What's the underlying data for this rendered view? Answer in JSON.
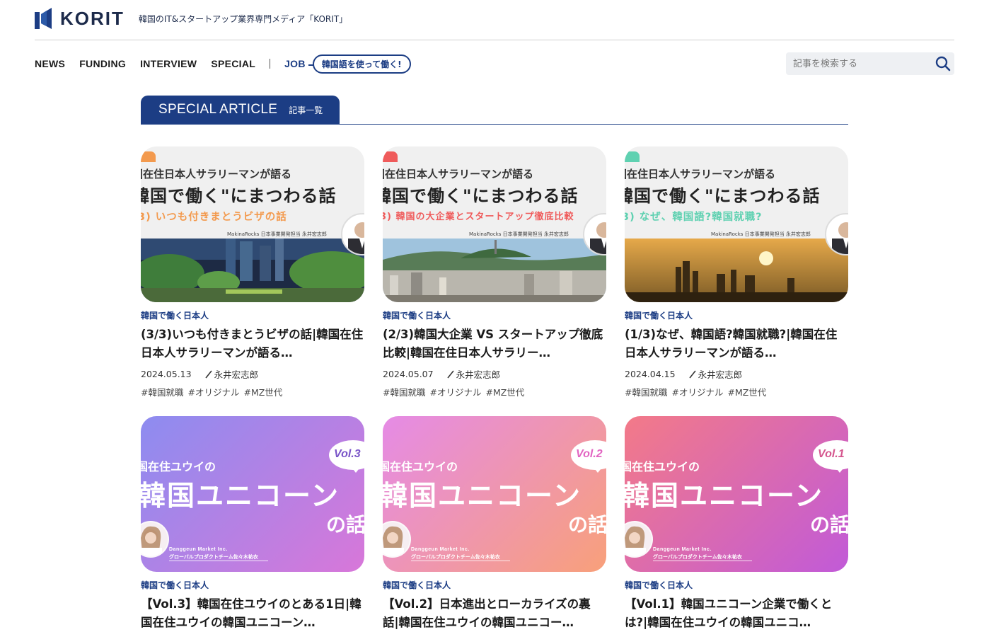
{
  "header": {
    "logo_text": "KORIT",
    "tagline": "韓国のIT&スタートアップ業界専門メディア「KORIT」",
    "brand_color": "#1c3d84"
  },
  "nav": {
    "items": [
      {
        "label": "NEWS"
      },
      {
        "label": "FUNDING"
      },
      {
        "label": "INTERVIEW"
      },
      {
        "label": "SPECIAL"
      }
    ],
    "job_label": "JOB",
    "job_bubble": "韓国語を使って働く!"
  },
  "search": {
    "placeholder": "記事を検索する",
    "icon": "search-icon"
  },
  "section": {
    "title": "SPECIAL ARTICLE",
    "subtitle": "記事一覧"
  },
  "cards": [
    {
      "category": "韓国で働く日本人",
      "title": "(3/3)いつも付きまとうビザの話|韓国在住日本人サラリーマンが語る…",
      "date": "2024.05.13",
      "author": "永井宏志郎",
      "tags": [
        "#韓国就職",
        "#オリジナル",
        "#MZ世代"
      ],
      "thumb": {
        "line1": "国在住日本人サラリーマンが語る",
        "line2": "韓国で働く\"にまつわる話",
        "line3": "3) いつも付きまとうビザの話",
        "credit": "MakinaRocks 日本事業開発担当 永井宏志郎",
        "accent": "#f39a4e"
      }
    },
    {
      "category": "韓国で働く日本人",
      "title": "(2/3)韓国大企業 VS スタートアップ徹底比較|韓国在住日本人サラリー…",
      "date": "2024.05.07",
      "author": "永井宏志郎",
      "tags": [
        "#韓国就職",
        "#オリジナル",
        "#MZ世代"
      ],
      "thumb": {
        "line1": "国在住日本人サラリーマンが語る",
        "line2": "韓国で働く\"にまつわる話",
        "line3": "3) 韓国の大企業とスタートアップ徹底比較",
        "credit": "MakinaRocks 日本事業開発担当 永井宏志郎",
        "accent": "#ef5b5b"
      }
    },
    {
      "category": "韓国で働く日本人",
      "title": "(1/3)なぜ、韓国語?韓国就職?|韓国在住日本人サラリーマンが語る…",
      "date": "2024.04.15",
      "author": "永井宏志郎",
      "tags": [
        "#韓国就職",
        "#オリジナル",
        "#MZ世代"
      ],
      "thumb": {
        "line1": "国在住日本人サラリーマンが語る",
        "line2": "韓国で働く\"にまつわる話",
        "line3": "3) なぜ、韓国語?韓国就職?",
        "credit": "MakinaRocks 日本事業開発担当 永井宏志郎",
        "accent": "#5fd1b1"
      }
    },
    {
      "category": "韓国で働く日本人",
      "title": "【Vol.3】韓国在住ユウイのとある1日|韓国在住ユウイの韓国ユニコーン…",
      "thumb": {
        "line1": "国在住ユウイの",
        "line2": "韓国ユニコーン",
        "line3": "の話",
        "vol": "Vol.3",
        "credit1": "Danggeun Market Inc.",
        "credit2": "グローバルプロダクトチーム佐々木祐衣",
        "color_from": "#8d8cf0",
        "color_to": "#d877d9"
      }
    },
    {
      "category": "韓国で働く日本人",
      "title": "【Vol.2】日本進出とローカライズの裏話|韓国在住ユウイの韓国ユニコー…",
      "thumb": {
        "line1": "国在住ユウイの",
        "line2": "韓国ユニコーン",
        "line3": "の話",
        "vol": "Vol.2",
        "credit1": "Danggeun Market Inc.",
        "credit2": "グローバルプロダクトチーム佐々木祐衣",
        "color_from": "#e58be6",
        "color_to": "#f8a07a"
      }
    },
    {
      "category": "韓国で働く日本人",
      "title": "【Vol.1】韓国ユニコーン企業で働くとは?|韓国在住ユウイの韓国ユニコ…",
      "thumb": {
        "line1": "国在住ユウイの",
        "line2": "韓国ユニコーン",
        "line3": "の話",
        "vol": "Vol.1",
        "credit1": "Danggeun Market Inc.",
        "credit2": "グローバルプロダクトチーム佐々木祐衣",
        "color_from": "#f37a88",
        "color_to": "#c15ad8"
      }
    }
  ]
}
